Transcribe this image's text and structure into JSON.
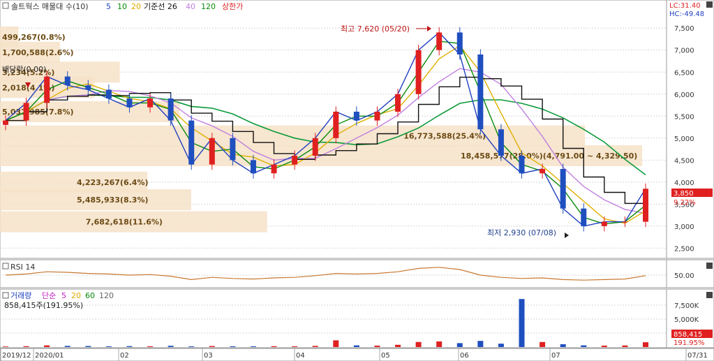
{
  "legend": {
    "title": "솔트웍스 매물대 수(10)",
    "ma5": "5",
    "ma10": "10",
    "ma20": "20",
    "base_label": "기준선 26",
    "ma40": "40",
    "ma120": "120",
    "limit_label": "상한가"
  },
  "top_right": {
    "lc": "LC:31.40",
    "hc": "HC:-49.48"
  },
  "rsi_label": "RSI 14",
  "volume_legend": {
    "title": "거래량",
    "simple": "단순",
    "p5": "5",
    "p20": "20",
    "p60": "60",
    "p120": "120",
    "last": "858,415주(191.95%)"
  },
  "price_badges": {
    "last": "3,850",
    "pct": "9.22%"
  },
  "volume_badges": {
    "last": "858,415",
    "pct": "191.95%"
  },
  "date_labels": [
    "2019/12",
    "2020/01",
    "02",
    "03",
    "04",
    "05",
    "06",
    "07",
    "07/31"
  ],
  "chart_data": [
    {
      "type": "candlestick",
      "title": "솔트웍스 매물대 수(10)",
      "x": [
        "2019-12-24",
        "2019-12-31",
        "2020-01-07",
        "2020-01-14",
        "2020-01-21",
        "2020-01-30",
        "2020-02-06",
        "2020-02-13",
        "2020-02-20",
        "2020-02-27",
        "2020-03-05",
        "2020-03-12",
        "2020-03-19",
        "2020-03-26",
        "2020-04-02",
        "2020-04-09",
        "2020-04-16",
        "2020-04-23",
        "2020-05-01",
        "2020-05-08",
        "2020-05-15",
        "2020-05-20",
        "2020-05-27",
        "2020-06-03",
        "2020-06-10",
        "2020-06-17",
        "2020-06-24",
        "2020-07-01",
        "2020-07-08",
        "2020-07-15",
        "2020-07-22",
        "2020-07-31"
      ],
      "close": [
        5400,
        5800,
        6400,
        6200,
        6100,
        5900,
        5700,
        5900,
        5400,
        4400,
        5000,
        4500,
        4200,
        4400,
        4600,
        5000,
        5600,
        5400,
        5600,
        6000,
        7000,
        7400,
        6900,
        5200,
        4600,
        4200,
        4300,
        3400,
        3000,
        3100,
        3100,
        3850
      ],
      "ylim": [
        2300,
        7900
      ],
      "yticks": [
        "7,500",
        "7,000",
        "6,500",
        "6,000",
        "5,500",
        "5,000",
        "4,500",
        "4,000",
        "3,500",
        "3,000",
        "2,500"
      ],
      "annotations": [
        "최고 7,620 (05/20)",
        "최저 2,930 (07/08)",
        "배당락(0.00)"
      ],
      "volume_profile": [
        {
          "label": "499,267(0.8%)"
        },
        {
          "label": "1,700,588(2.6%)"
        },
        {
          "label": "3,234(5.2%)"
        },
        {
          "label": "2,018(4.1%)"
        },
        {
          "label": "5,032,985(7.8%)"
        },
        {
          "label": "16,773,588(25.4%)"
        },
        {
          "label": "18,458,577(28.0%)(4,791.00 ~ 4,329.50)"
        },
        {
          "label": "4,223,267(6.4%)"
        },
        {
          "label": "5,485,933(8.3%)"
        },
        {
          "label": "7,682,618(11.6%)"
        }
      ]
    },
    {
      "type": "line",
      "title": "RSI 14",
      "yticks": [
        "50.00"
      ],
      "values": [
        50,
        52,
        56,
        55,
        53,
        52,
        50,
        51,
        48,
        42,
        46,
        44,
        43,
        45,
        46,
        49,
        53,
        52,
        53,
        56,
        62,
        64,
        60,
        50,
        46,
        44,
        45,
        42,
        41,
        42,
        43,
        49
      ]
    },
    {
      "type": "bar",
      "title": "거래량",
      "yticks": [
        "7,500K",
        "5,000K",
        "2,500K"
      ],
      "values_k": [
        100,
        150,
        300,
        200,
        180,
        120,
        160,
        140,
        220,
        120,
        180,
        130,
        120,
        150,
        130,
        200,
        1200,
        300,
        250,
        400,
        900,
        1000,
        700,
        1100,
        600,
        8600,
        900,
        500,
        300,
        250,
        280,
        858
      ]
    }
  ]
}
